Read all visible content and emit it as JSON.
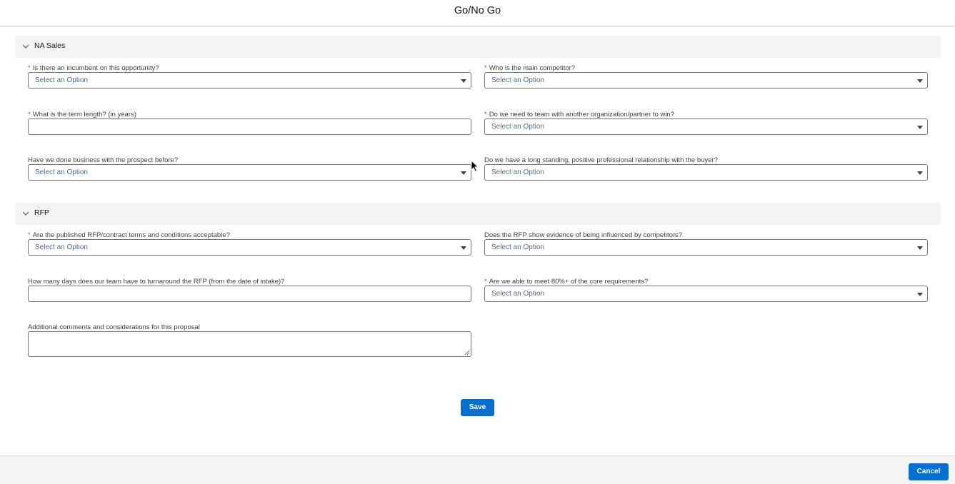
{
  "modal": {
    "title": "Go/No Go"
  },
  "sections": {
    "na_sales": {
      "title": "NA Sales",
      "fields": {
        "incumbent": {
          "label": "Is there an incumbent on this opportunity?",
          "required": "*",
          "value": "Select an Option"
        },
        "competitor": {
          "label": "Who is the main competitor?",
          "required": "*",
          "value": "Select an Option"
        },
        "term_length": {
          "label": "What is the term length? (in years)",
          "required": "*",
          "value": ""
        },
        "team_partner": {
          "label": "Do we need to team with another organization/partner to win?",
          "required": "*",
          "value": "Select an Option"
        },
        "done_business": {
          "label": "Have we done business with the prospect before?",
          "value": "Select an Option"
        },
        "relationship": {
          "label": "Do we have a long standing, positive professional relationship with the buyer?",
          "value": "Select an Option"
        }
      }
    },
    "rfp": {
      "title": "RFP",
      "fields": {
        "terms_acceptable": {
          "label": "Are the published RFP/contract terms and conditions acceptable?",
          "required": "*",
          "value": "Select an Option"
        },
        "influenced": {
          "label": "Does the RFP show evidence of being influenced by competitors?",
          "value": "Select an Option"
        },
        "turnaround_days": {
          "label": "How many days does our team have to turnaround the RFP (from the date of intake)?",
          "value": ""
        },
        "core_requirements": {
          "label": "Are we able to meet 80%+ of the core requirements?",
          "required": "*",
          "value": "Select an Option"
        },
        "comments": {
          "label": "Additional comments and considerations for this proposal",
          "value": ""
        }
      }
    }
  },
  "actions": {
    "save_label": "Save",
    "cancel_label": "Cancel"
  },
  "colors": {
    "brand": "#0070d2",
    "required": "#c23934",
    "section_bg": "#f3f3f3"
  },
  "icons": {
    "section_toggle": "chevron-down-icon",
    "dropdown": "caret-down-icon",
    "cursor": "mouse-pointer-icon"
  }
}
